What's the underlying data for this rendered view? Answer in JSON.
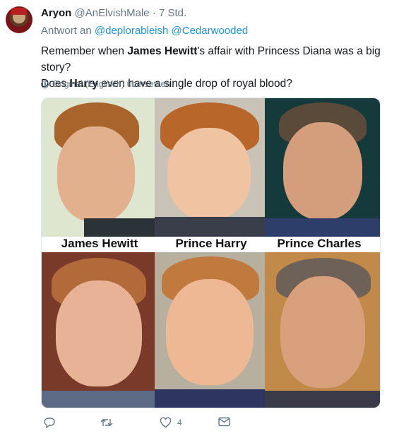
{
  "author": {
    "name": "Aryon",
    "handle": "@AnElvishMale",
    "separator": "·",
    "time": "7 Std."
  },
  "reply": {
    "prefix": "Antwort an",
    "mention1": "@deplorableish",
    "mention2": "@Cedarwooded"
  },
  "body": {
    "part1": "Remember when ",
    "bold1": "James Hewitt",
    "part2": "'s affair with Princess Diana was a big story?",
    "part3": "Does ",
    "bold2": "Harry",
    "part4": " even have a single drop of royal blood?"
  },
  "translate_label": "Original (Englisch) übersetzen",
  "media": {
    "captions": [
      "James Hewitt",
      "Prince Harry",
      "Prince Charles"
    ]
  },
  "actions": {
    "reply_icon": "reply-icon",
    "retweet_icon": "retweet-icon",
    "like_icon": "heart-icon",
    "like_count": "4",
    "dm_icon": "envelope-icon"
  },
  "colors": {
    "link": "#1b95e0",
    "secondary_text": "#657786"
  }
}
